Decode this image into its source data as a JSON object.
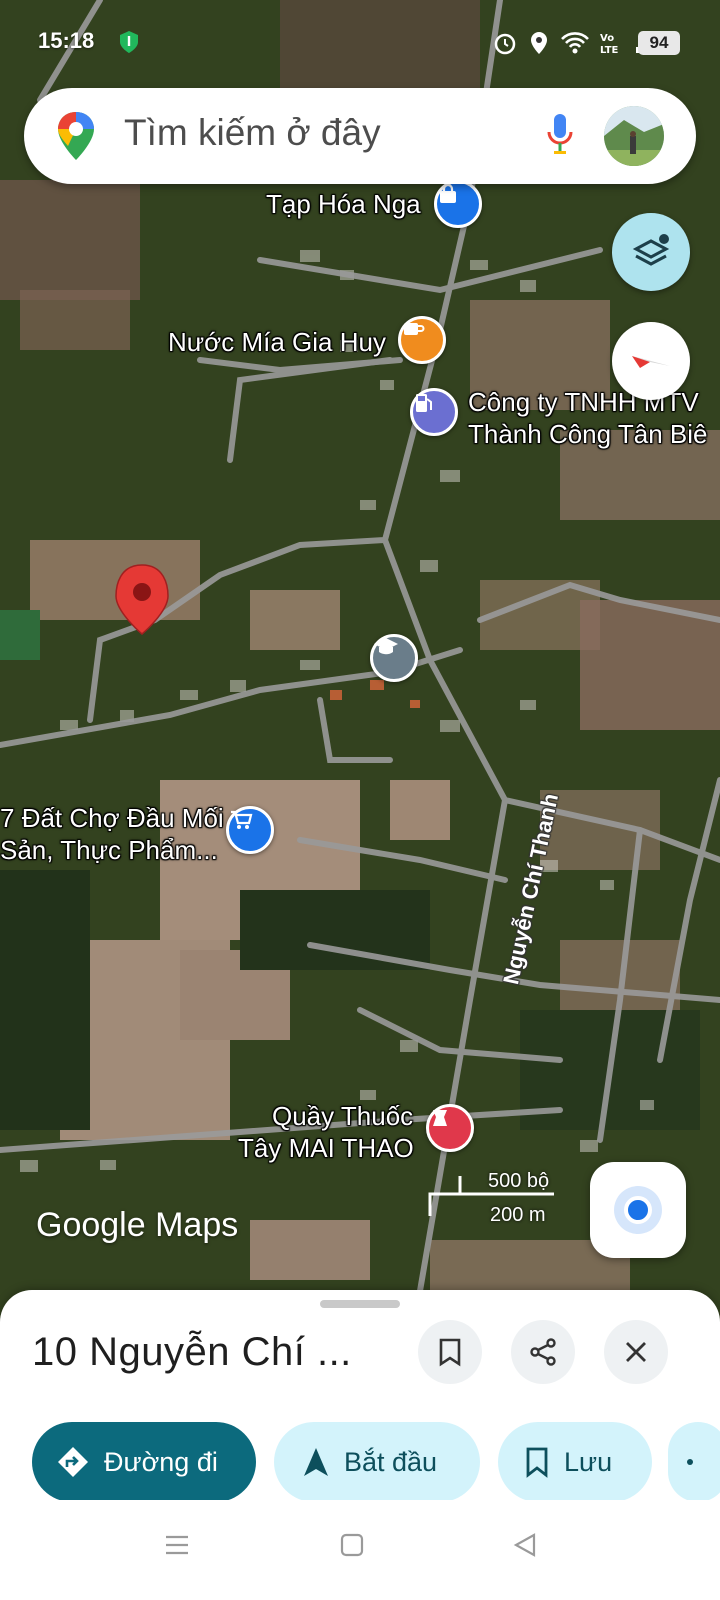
{
  "status_bar": {
    "time": "15:18",
    "battery": "94",
    "network": "LTE"
  },
  "search": {
    "placeholder": "Tìm kiếm ở đây"
  },
  "map": {
    "pois": [
      {
        "label": "Tạp Hóa Nga",
        "icon": "shopping-bag-icon",
        "color": "#1a73e8"
      },
      {
        "label": "Nước Mía Gia Huy",
        "icon": "coffee-cup-icon",
        "color": "#f08c1e"
      },
      {
        "label_line1": "Công ty TNHH MTV",
        "label_line2": "Thành Công Tân Biê",
        "icon": "gas-station-icon",
        "color": "#6b6fd1"
      },
      {
        "label": "",
        "icon": "school-icon",
        "color": "#6a7d8a"
      },
      {
        "label_line1": "Đất Chợ Đầu Mối",
        "label_line2": "Sản, Thực Phẩm...",
        "icon": "shopping-cart-icon",
        "color": "#1a73e8"
      },
      {
        "label_line1": "Quầy Thuốc",
        "label_line2": "Tây MAI THAO",
        "icon": "pharmacy-icon",
        "color": "#e0384b"
      }
    ],
    "road_name": "Nguyễn Chí Thanh",
    "scale_imperial": "500 bộ",
    "scale_metric": "200 m",
    "watermark": "Google Maps",
    "pin_color": "#e53935"
  },
  "sheet": {
    "title": "10 Nguyễn Chí ...",
    "actions": {
      "directions": "Đường đi",
      "start": "Bắt đầu",
      "save": "Lưu"
    }
  },
  "colors": {
    "primary_chip": "#0c6a7d",
    "secondary_chip": "#d3f3fb"
  }
}
